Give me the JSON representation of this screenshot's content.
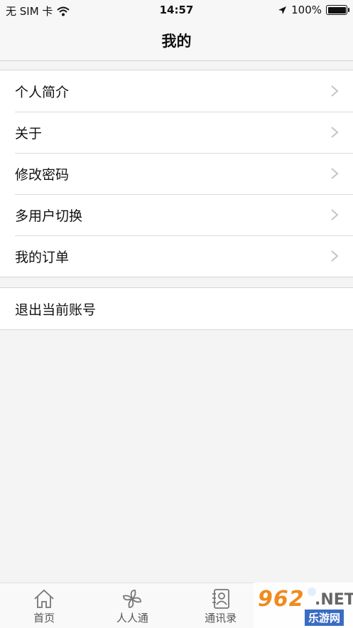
{
  "status_bar": {
    "carrier": "无 SIM 卡",
    "time": "14:57",
    "battery_percent": "100%",
    "icons": [
      "wifi-icon",
      "location-arrow-icon",
      "battery-icon"
    ]
  },
  "nav": {
    "title": "我的"
  },
  "menu": {
    "items": [
      {
        "label": "个人简介"
      },
      {
        "label": "关于"
      },
      {
        "label": "修改密码"
      },
      {
        "label": "多用户切换"
      },
      {
        "label": "我的订单"
      }
    ]
  },
  "logout": {
    "label": "退出当前账号"
  },
  "tabs": [
    {
      "label": "首页",
      "icon": "home-icon"
    },
    {
      "label": "人人通",
      "icon": "pinwheel-icon"
    },
    {
      "label": "通讯录",
      "icon": "contacts-icon"
    },
    {
      "label": "",
      "icon": "profile-icon"
    }
  ],
  "watermark": {
    "logo": "962",
    "suffix": ".NET",
    "site": "乐游网"
  },
  "colors": {
    "background": "#f4f4f4",
    "badge": "#3b8cf0",
    "watermark_orange": "#f08a1e",
    "watermark_blue": "#3a6cc4"
  }
}
